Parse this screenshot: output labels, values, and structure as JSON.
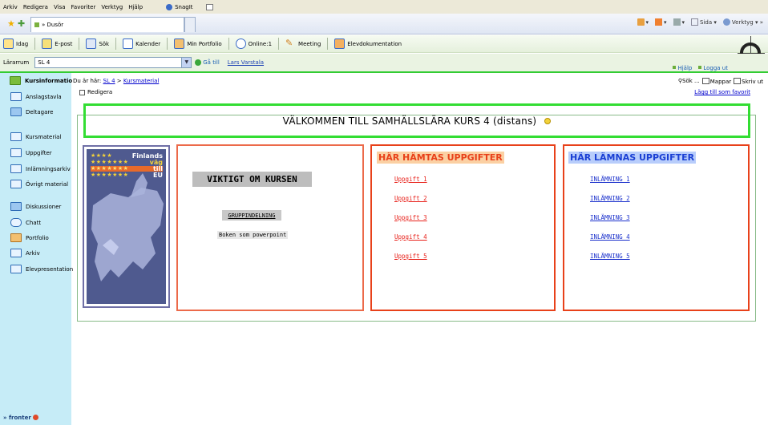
{
  "ie_menu": {
    "items": [
      "Arkiv",
      "Redigera",
      "Visa",
      "Favoriter",
      "Verktyg",
      "Hjälp"
    ],
    "snagit": "SnagIt"
  },
  "browser": {
    "tab_title": "» Dusör",
    "tools": {
      "page": "Sida",
      "tools": "Verktyg"
    }
  },
  "topnav": {
    "items": [
      {
        "label": "Idag"
      },
      {
        "label": "E-post"
      },
      {
        "label": "Sök"
      },
      {
        "label": "Kalender"
      },
      {
        "label": "Min Portfolio"
      },
      {
        "label": "Online:1"
      },
      {
        "label": "Meeting"
      },
      {
        "label": "Elevdokumentation"
      }
    ]
  },
  "roombar": {
    "label": "Lärarrum",
    "selected": "SL 4",
    "goto": "Gå till",
    "user": "Lars Varstala",
    "help": "Hjälp",
    "logout": "Logga ut"
  },
  "sidebar": {
    "items": [
      {
        "label": "Kursinformatio"
      },
      {
        "label": "Anslagstavla"
      },
      {
        "label": "Deltagare"
      },
      {
        "label": "Kursmaterial"
      },
      {
        "label": "Uppgifter"
      },
      {
        "label": "Inlämningsarkiv"
      },
      {
        "label": "Övrigt material"
      },
      {
        "label": "Diskussioner"
      },
      {
        "label": "Chatt"
      },
      {
        "label": "Portfolio"
      },
      {
        "label": "Arkiv"
      },
      {
        "label": "Elevpresentation"
      }
    ],
    "logo": "» fronter"
  },
  "header": {
    "crumb_prefix": "Du är här:",
    "crumb_room": "SL 4",
    "crumb_sep": ">",
    "crumb_page": "Kursmaterial",
    "edit": "Redigera",
    "search": "Sök ...",
    "folders": "Mappar",
    "print": "Skriv ut",
    "add_fav": "Lägg till som favorit"
  },
  "main": {
    "title": "VÄLKOMMEN TILL SAMHÄLLSLÄRA KURS 4 (distans)",
    "image": {
      "lines": [
        "Finlands",
        "väg",
        "till",
        "EU"
      ]
    },
    "box1": {
      "heading": "VIKTIGT OM KURSEN",
      "link1": "GRUPPINDELNING",
      "link2": "Boken som powerpoint"
    },
    "box2": {
      "heading": "HÄR HÄMTAS UPPGIFTER",
      "links": [
        "Uppgift 1",
        "Uppgift 2",
        "Uppgift 3",
        "Uppgift 4",
        "Uppgift 5"
      ]
    },
    "box3": {
      "heading": "HÄR LÄMNAS UPPGIFTER",
      "links": [
        "INLÄMNING 1",
        "INLÄMNING 2",
        "INLÄMNING 3",
        "INLÄMNING 4",
        "INLÄMNING 5"
      ]
    }
  },
  "colors": {
    "green_border": "#33dd33",
    "orange_border": "#e8411a",
    "sidebar_bg": "#c6ecf7",
    "link_blue": "#1a30cc",
    "link_red": "#e8211a"
  }
}
